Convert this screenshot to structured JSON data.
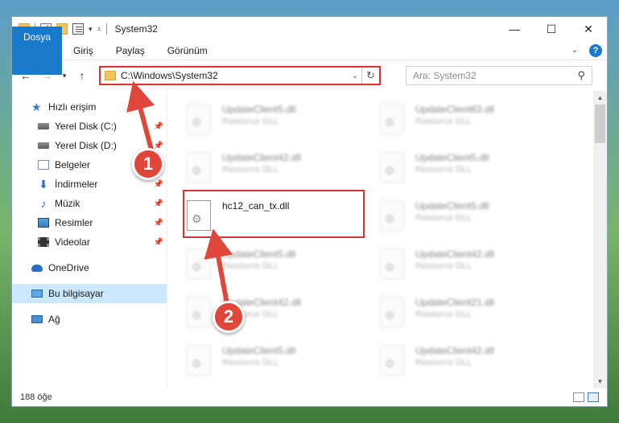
{
  "window": {
    "title": "System32",
    "controls": {
      "minimize": "—",
      "maximize": "☐",
      "close": "✕"
    }
  },
  "ribbon": {
    "tabs": [
      "Dosya",
      "Giriş",
      "Paylaş",
      "Görünüm"
    ],
    "help": "?"
  },
  "nav": {
    "address": "C:\\Windows\\System32",
    "search_placeholder": "Ara: System32"
  },
  "sidebar": {
    "items": [
      {
        "label": "Hızlı erişim"
      },
      {
        "label": "Yerel Disk (C:)"
      },
      {
        "label": "Yerel Disk (D:)"
      },
      {
        "label": "Belgeler"
      },
      {
        "label": "İndirmeler"
      },
      {
        "label": "Müzik"
      },
      {
        "label": "Resimler"
      },
      {
        "label": "Videolar"
      },
      {
        "label": "OneDrive"
      },
      {
        "label": "Bu bilgisayar"
      },
      {
        "label": "Ağ"
      }
    ]
  },
  "files": [
    {
      "name": "UpdateClient5.dll",
      "type": "Resource DLL"
    },
    {
      "name": "UpdateClient63.dll",
      "type": "Resource DLL"
    },
    {
      "name": "UpdateClient42.dll",
      "type": "Resource DLL"
    },
    {
      "name": "UpdateClient5.dll",
      "type": "Resource DLL"
    },
    {
      "name": "hc12_can_tx.dll",
      "type": ""
    },
    {
      "name": "UpdateClient5.dll",
      "type": "Resource DLL"
    },
    {
      "name": "UpdateClient5.dll",
      "type": "Resource DLL"
    },
    {
      "name": "UpdateClient42.dll",
      "type": "Resource DLL"
    },
    {
      "name": "UpdateClient42.dll",
      "type": "Resource DLL"
    },
    {
      "name": "UpdateClient21.dll",
      "type": "Resource DLL"
    },
    {
      "name": "UpdateClient5.dll",
      "type": "Resource DLL"
    },
    {
      "name": "UpdateClient42.dll",
      "type": "Resource DLL"
    }
  ],
  "status": {
    "count": "188 öğe"
  },
  "annotations": {
    "step1": "1",
    "step2": "2",
    "color": "#e0463a"
  }
}
